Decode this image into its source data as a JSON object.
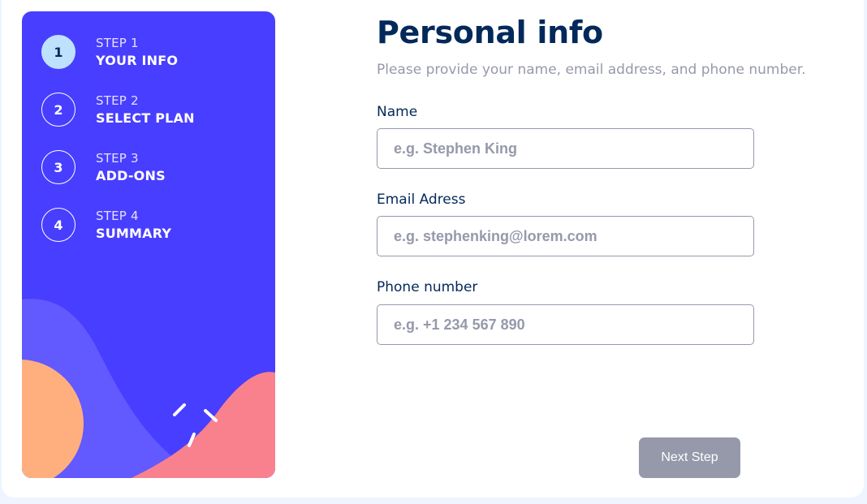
{
  "sidebar": {
    "steps": [
      {
        "number": "1",
        "step_label": "STEP 1",
        "name": "YOUR INFO",
        "active": true
      },
      {
        "number": "2",
        "step_label": "STEP 2",
        "name": "SELECT PLAN",
        "active": false
      },
      {
        "number": "3",
        "step_label": "STEP 3",
        "name": "ADD-ONS",
        "active": false
      },
      {
        "number": "4",
        "step_label": "STEP 4",
        "name": "SUMMARY",
        "active": false
      }
    ]
  },
  "form": {
    "title": "Personal info",
    "subtitle": "Please provide your name, email address, and phone number.",
    "fields": [
      {
        "label": "Name",
        "placeholder": "e.g. Stephen King",
        "value": ""
      },
      {
        "label": "Email Adress",
        "placeholder": "e.g. stephenking@lorem.com",
        "value": ""
      },
      {
        "label": "Phone number",
        "placeholder": "e.g. +1 234 567 890",
        "value": ""
      }
    ],
    "next_label": "Next Step"
  },
  "colors": {
    "sidebar_bg": "#483eff",
    "active_step": "#bee2fd",
    "title": "#022959",
    "muted": "#9699aa",
    "coral": "#f9818e",
    "orange": "#ffaf7e",
    "lavender": "#6259ff"
  }
}
